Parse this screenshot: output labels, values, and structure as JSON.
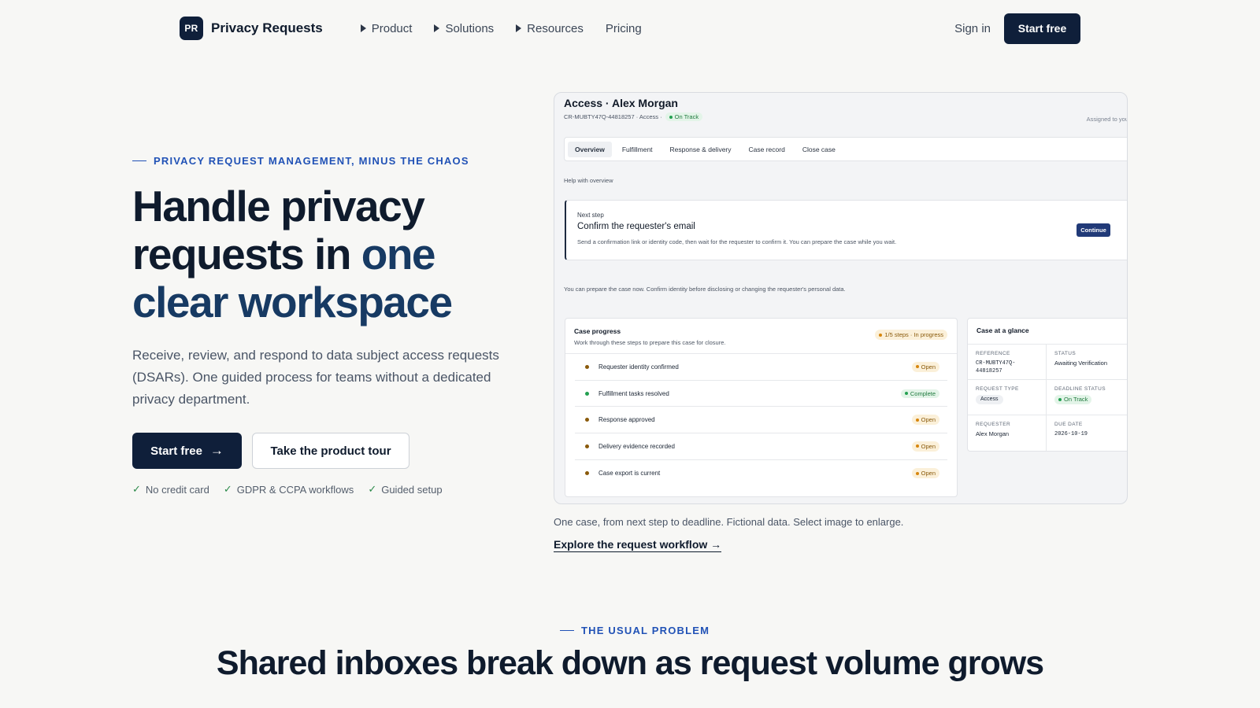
{
  "nav": {
    "logo_mark": "PR",
    "logo_text": "Privacy Requests",
    "menu": [
      {
        "label": "Product",
        "has_submenu": true
      },
      {
        "label": "Solutions",
        "has_submenu": true
      },
      {
        "label": "Resources",
        "has_submenu": true
      },
      {
        "label": "Pricing",
        "has_submenu": false
      }
    ],
    "sign_in": "Sign in",
    "start_free": "Start free"
  },
  "hero": {
    "eyebrow": "PRIVACY REQUEST MANAGEMENT, MINUS THE CHAOS",
    "title_part1": "Handle privacy requests in ",
    "title_accent": "one clear workspace",
    "subtitle": "Receive, review, and respond to data subject access requests (DSARs). One guided process for teams without a dedicated privacy department.",
    "cta_primary": "Start free",
    "cta_secondary": "Take the product tour",
    "checks": [
      "No credit card",
      "GDPR & CCPA workflows",
      "Guided setup"
    ]
  },
  "screenshot": {
    "title": "Access · Alex Morgan",
    "meta": "CR-MUBTY47Q-44818257 · Access ·",
    "status": "On Track",
    "assigned": "Assigned to you",
    "tabs": [
      "Overview",
      "Fulfillment",
      "Response & delivery",
      "Case record",
      "Close case"
    ],
    "help": "Help with overview",
    "next_step": {
      "label": "Next step",
      "title": "Confirm the requester's email",
      "description": "Send a confirmation link or identity code, then wait for the requester to confirm it. You can prepare the case while you wait.",
      "button": "Continue"
    },
    "note": "You can prepare the case now. Confirm identity before disclosing or changing the requester's personal data.",
    "progress": {
      "title": "Case progress",
      "subtitle": "Work through these steps to prepare this case for closure.",
      "badge": "1/5 steps · In progress",
      "rows": [
        {
          "label": "Requester identity confirmed",
          "status": "Open"
        },
        {
          "label": "Fulfillment tasks resolved",
          "status": "Complete"
        },
        {
          "label": "Response approved",
          "status": "Open"
        },
        {
          "label": "Delivery evidence recorded",
          "status": "Open"
        },
        {
          "label": "Case export is current",
          "status": "Open"
        }
      ]
    },
    "glance": {
      "title": "Case at a glance",
      "reference_key": "REFERENCE",
      "reference_val": "CR-MUBTY47Q-44818257",
      "status_key": "STATUS",
      "status_val": "Awaiting Verification",
      "type_key": "REQUEST TYPE",
      "type_val": "Access",
      "deadline_key": "DEADLINE STATUS",
      "deadline_val": "On Track",
      "requester_key": "REQUESTER",
      "requester_val": "Alex Morgan",
      "due_key": "DUE DATE",
      "due_val": "2026-10-19"
    }
  },
  "caption": "One case, from next step to deadline. Fictional data. Select image to enlarge.",
  "explore_link": "Explore the request workflow →",
  "problem": {
    "eyebrow": "THE USUAL PROBLEM",
    "title": "Shared inboxes break down as request volume grows"
  },
  "colors": {
    "brand_dark": "#0f1f3a",
    "accent_blue": "#2152b6",
    "success_green": "#24a051",
    "warning_amber": "#d7860d"
  }
}
